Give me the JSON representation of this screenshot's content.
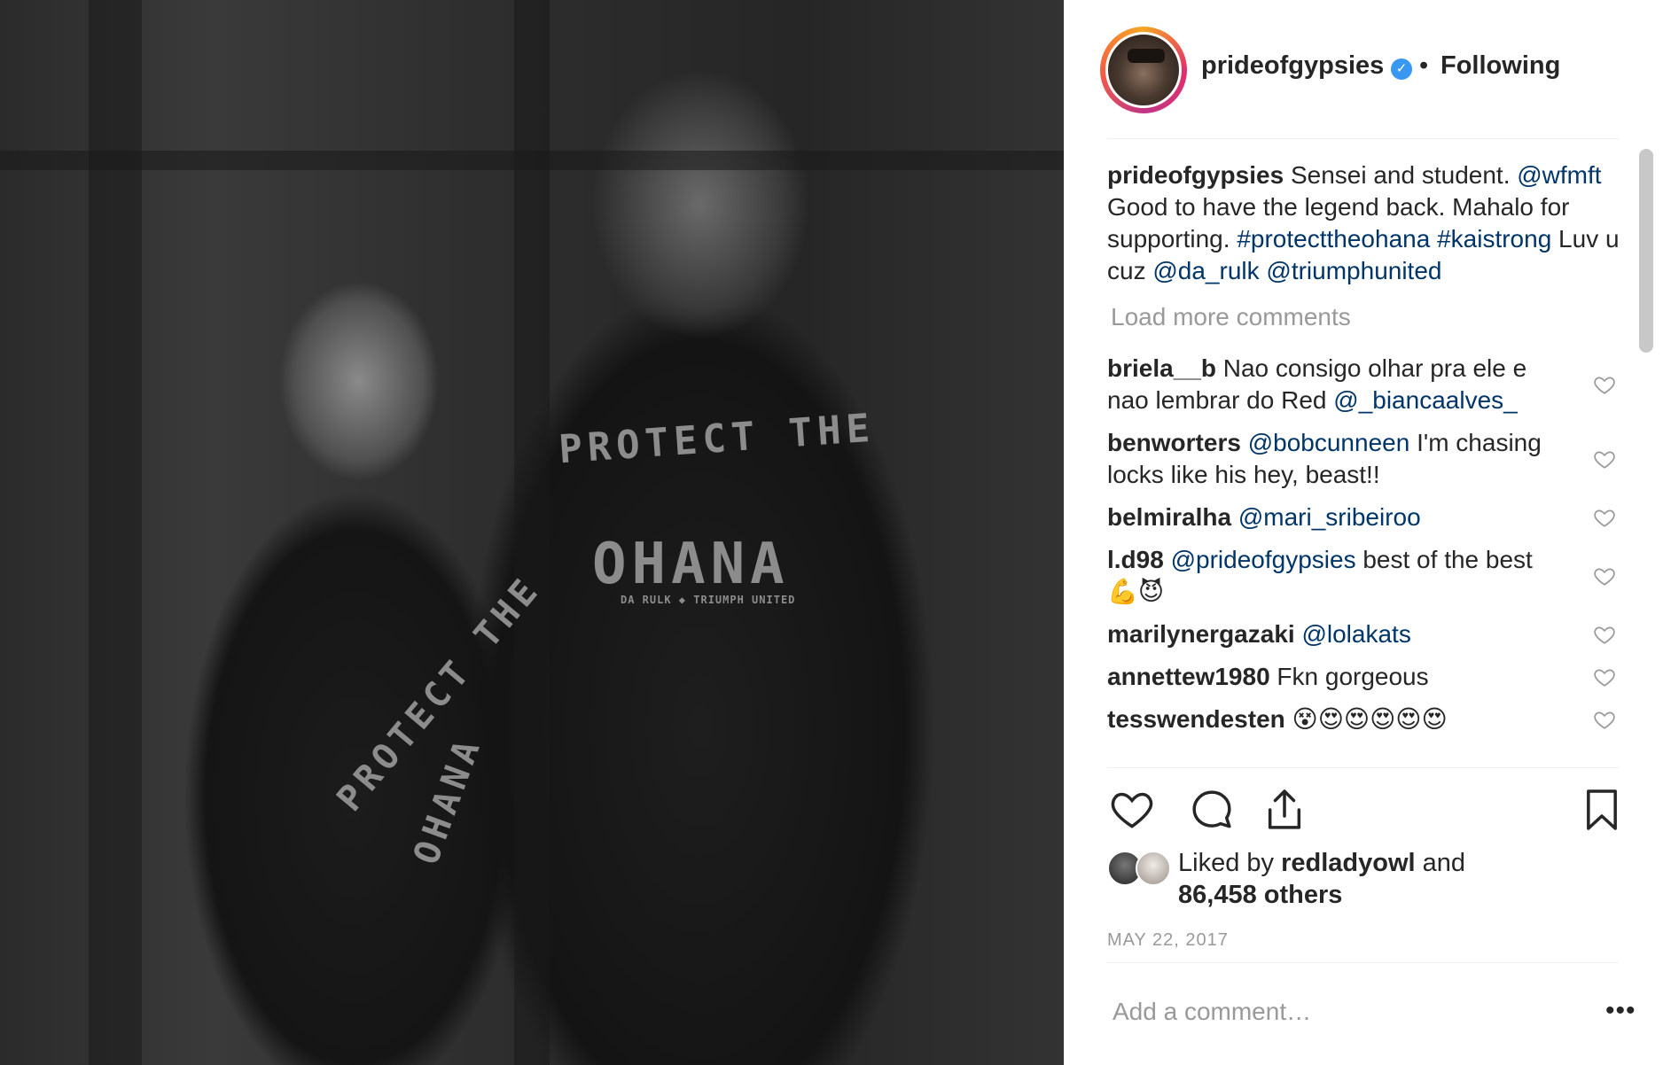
{
  "post": {
    "image_alt": "Black and white photo of two men in Protect The Ohana t-shirts",
    "shirt_text_1": "PROTECT THE",
    "shirt_text_2": "OHANA",
    "shirt_small": "DA RULK ◆ TRIUMPH UNITED"
  },
  "header": {
    "username": "prideofgypsies",
    "verified_icon": "verified-badge-icon",
    "separator": "•",
    "follow_state": "Following"
  },
  "caption": {
    "username": "prideofgypsies",
    "text_1": " Sensei and student. ",
    "mention_1": "@wfmft",
    "text_2": " Good to have the legend back. Mahalo for supporting. ",
    "hashtag_1": "#protecttheohana",
    "hashtag_2": "#kaistrong",
    "text_3": " Luv u cuz ",
    "mention_2": "@da_rulk",
    "mention_3": "@triumphunited"
  },
  "load_more": "Load more comments",
  "comments": [
    {
      "user": "briela__b",
      "text": " Nao consigo olhar pra ele e nao lembrar do Red ",
      "mention": "@_biancaalves_",
      "after": ""
    },
    {
      "user": "benworters",
      "text": " ",
      "mention": "@bobcunneen",
      "after": " I'm chasing locks like his hey, beast!!"
    },
    {
      "user": "belmiralha",
      "text": " ",
      "mention": "@mari_sribeiroo",
      "after": ""
    },
    {
      "user": "l.d98",
      "text": " ",
      "mention": "@prideofgypsies",
      "after": " best of the best 💪😈"
    },
    {
      "user": "marilynergazaki",
      "text": " ",
      "mention": "@lolakats",
      "after": ""
    },
    {
      "user": "annettew1980",
      "text": " Fkn gorgeous",
      "mention": "",
      "after": ""
    },
    {
      "user": "tesswendesten",
      "text": " 😵😍😍😍😍😍",
      "mention": "",
      "after": ""
    }
  ],
  "likes": {
    "prefix": "Liked by ",
    "user": "redladyowl",
    "middle": " and",
    "count": "86,458 others"
  },
  "date": "MAY 22, 2017",
  "add_comment_placeholder": "Add a comment…",
  "more_options": "•••"
}
